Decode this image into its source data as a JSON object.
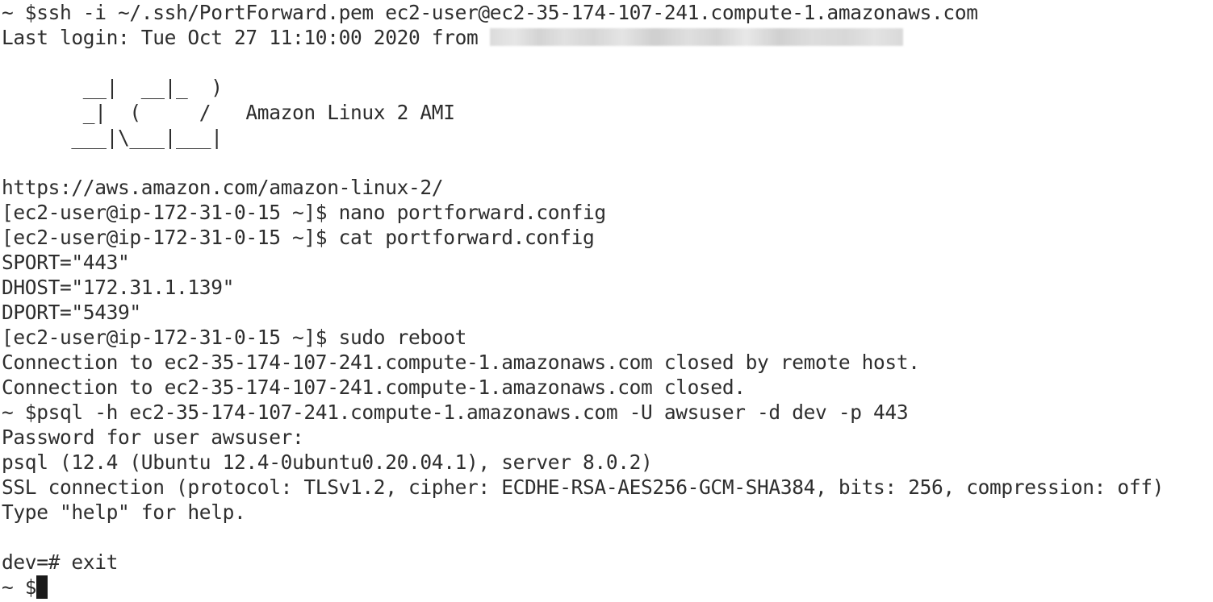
{
  "terminal": {
    "lines": [
      "~ $ssh -i ~/.ssh/PortForward.pem ec2-user@ec2-35-174-107-241.compute-1.amazonaws.com",
      "Last login: Tue Oct 27 11:10:00 2020 from ",
      "",
      "       __|  __|_  )",
      "       _|  (     /   Amazon Linux 2 AMI",
      "      ___|\\___|___|",
      "",
      "https://aws.amazon.com/amazon-linux-2/",
      "[ec2-user@ip-172-31-0-15 ~]$ nano portforward.config",
      "[ec2-user@ip-172-31-0-15 ~]$ cat portforward.config",
      "SPORT=\"443\"",
      "DHOST=\"172.31.1.139\"",
      "DPORT=\"5439\"",
      "[ec2-user@ip-172-31-0-15 ~]$ sudo reboot",
      "Connection to ec2-35-174-107-241.compute-1.amazonaws.com closed by remote host.",
      "Connection to ec2-35-174-107-241.compute-1.amazonaws.com closed.",
      "~ $psql -h ec2-35-174-107-241.compute-1.amazonaws.com -U awsuser -d dev -p 443",
      "Password for user awsuser:",
      "psql (12.4 (Ubuntu 12.4-0ubuntu0.20.04.1), server 8.0.2)",
      "SSL connection (protocol: TLSv1.2, cipher: ECDHE-RSA-AES256-GCM-SHA384, bits: 256, compression: off)",
      "Type \"help\" for help.",
      "",
      "dev=# exit",
      "~ $"
    ]
  }
}
